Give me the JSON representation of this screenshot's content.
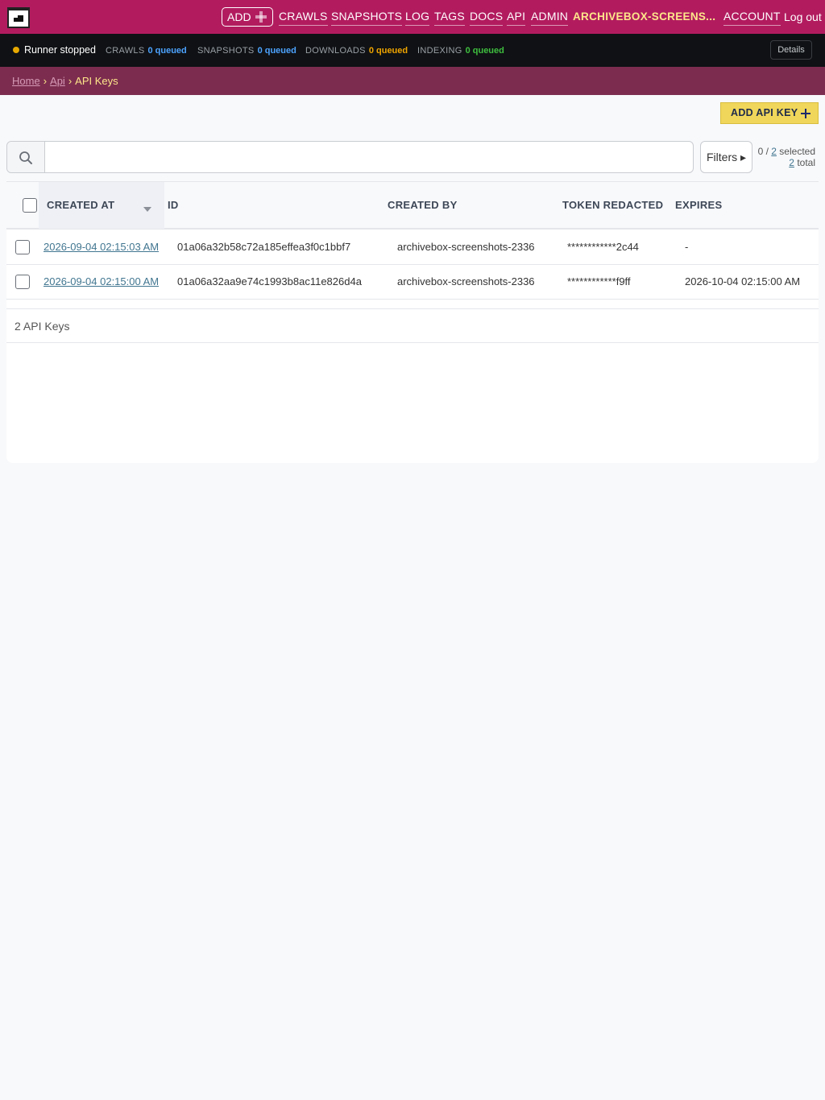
{
  "nav": {
    "add_label": "ADD",
    "links": [
      "CRAWLS",
      "SNAPSHOTS",
      "LOG",
      "TAGS",
      "DOCS",
      "API",
      "ADMIN"
    ],
    "user": "ARCHIVEBOX-SCREENS...",
    "account": "ACCOUNT",
    "logout": "Log out"
  },
  "status": {
    "runner": "Runner stopped",
    "queues": [
      {
        "label": "CRAWLS",
        "value": "0 queued",
        "color": "#4da3ff"
      },
      {
        "label": "SNAPSHOTS",
        "value": "0 queued",
        "color": "#4da3ff"
      },
      {
        "label": "DOWNLOADS",
        "value": "0 queued",
        "color": "#f0a500"
      },
      {
        "label": "INDEXING",
        "value": "0 queued",
        "color": "#3fbf3f"
      }
    ],
    "details": "Details"
  },
  "breadcrumb": {
    "home": "Home",
    "api": "Api",
    "sep": "›",
    "current": "API Keys"
  },
  "actions": {
    "add_key": "ADD API KEY"
  },
  "search": {
    "value": "",
    "placeholder": ""
  },
  "filters": {
    "label": "Filters ▸",
    "selected_prefix": "0 / ",
    "selected_link": "2",
    "selected_suffix": " selected",
    "total_link": "2",
    "total_suffix": " total"
  },
  "table": {
    "headers": [
      "CREATED AT",
      "ID",
      "CREATED BY",
      "TOKEN REDACTED",
      "EXPIRES"
    ],
    "rows": [
      {
        "created_at": "2026-09-04 02:15:03 AM",
        "id": "01a06a32b58c72a185effea3f0c1bbf7",
        "created_by": "archivebox-screenshots-2336",
        "token": "************2c44",
        "expires": "-"
      },
      {
        "created_at": "2026-09-04 02:15:00 AM",
        "id": "01a06a32aa9e74c1993b8ac11e826d4a",
        "created_by": "archivebox-screenshots-2336",
        "token": "************f9ff",
        "expires": "2026-10-04 02:15:00 AM"
      }
    ],
    "footer": "2 API Keys"
  },
  "colors": {
    "nav_bg": "#b21c5f",
    "status_bg": "#0f1114",
    "crumb_bg": "#7c2d4f",
    "add_key_bg": "#f0d65a",
    "user_link": "#fde68a",
    "link": "#417690"
  },
  "icons": {
    "logo": "archivebox-logo-icon",
    "add_plus": "plus-icon",
    "search": "search-icon",
    "status": "status-dot-icon",
    "sort": "sort-desc-icon"
  }
}
